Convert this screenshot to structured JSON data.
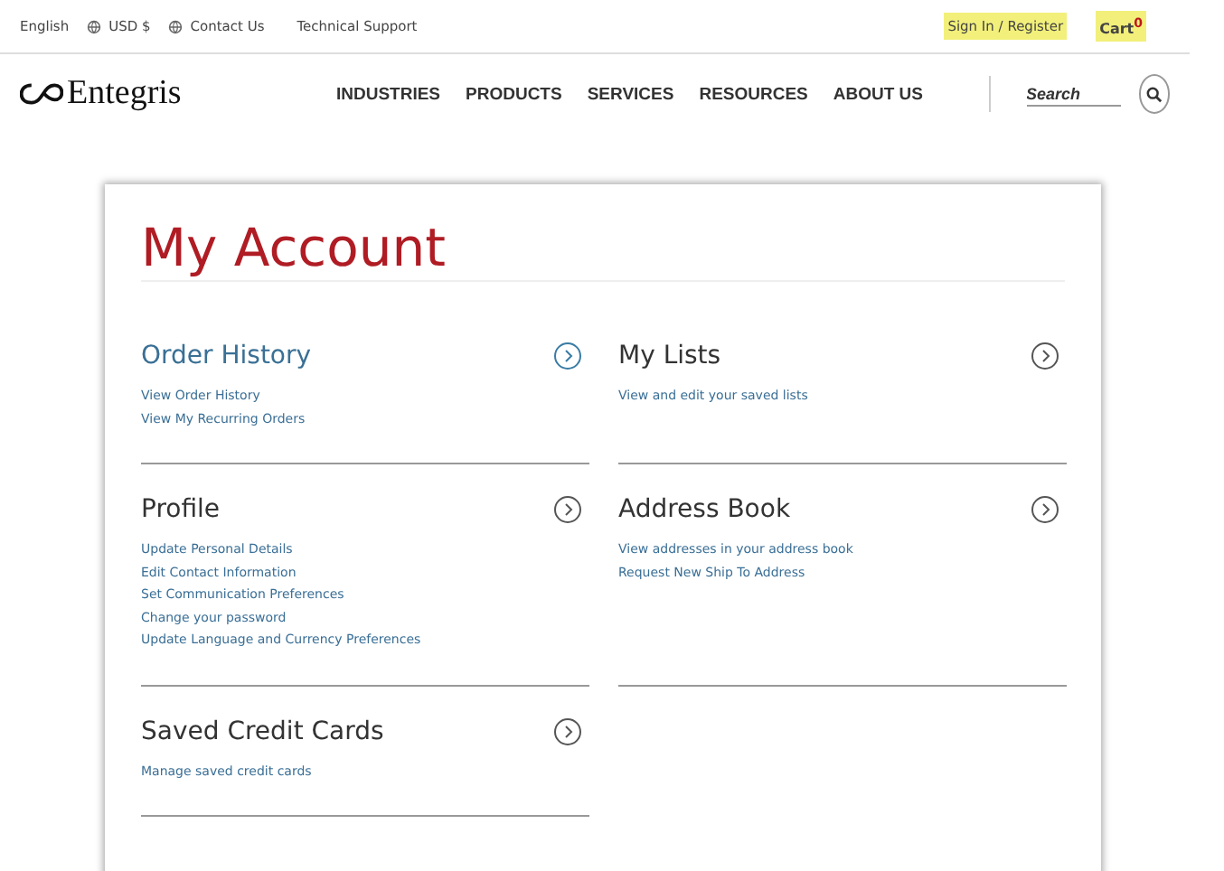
{
  "top_bar": {
    "left": [
      {
        "label": "English",
        "kind": "text"
      },
      {
        "label": "USD $",
        "kind": "globe"
      },
      {
        "label": "Contact Us",
        "kind": "globe"
      },
      {
        "label": "Technical Support",
        "kind": "text"
      }
    ],
    "right": [
      {
        "label": "Sign In / Register",
        "highlighted": true
      },
      {
        "label": "Cart",
        "badge": "0",
        "highlighted": true
      }
    ]
  },
  "header": {
    "logo": "Entegris",
    "nav": [
      "INDUSTRIES",
      "PRODUCTS",
      "SERVICES",
      "RESOURCES",
      "ABOUT US"
    ],
    "search": {
      "placeholder": "Search"
    }
  },
  "page": {
    "title": "My Account",
    "sections": [
      {
        "title": "Order History",
        "highlighted": true,
        "links": [
          "View Order History",
          "View My Recurring Orders"
        ]
      },
      {
        "title": "My Lists",
        "highlighted": false,
        "links": [
          "View and edit your saved lists"
        ]
      },
      {
        "title": "Profile",
        "highlighted": false,
        "links": [
          "Update Personal Details",
          "Edit Contact Information",
          "Set Communication Preferences",
          "Change your password",
          "Update Language and Currency Preferences"
        ]
      },
      {
        "title": "Address Book",
        "highlighted": false,
        "links": [
          "View addresses in your address book",
          "Request New Ship To Address"
        ]
      },
      {
        "title": "Saved Credit Cards",
        "highlighted": false,
        "links": [
          "Manage saved credit cards"
        ]
      }
    ]
  }
}
